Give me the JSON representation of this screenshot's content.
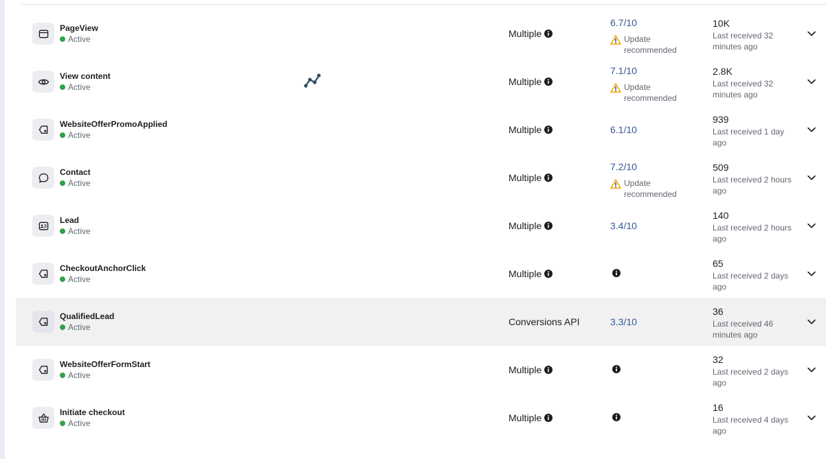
{
  "events": [
    {
      "name": "PageView",
      "status": "Active",
      "icon": "browser-window-icon",
      "integration": "Multiple",
      "score": "6.7/10",
      "warning": "Update recommended",
      "count": "10K",
      "last_received": "Last received 32 minutes ago"
    },
    {
      "name": "View content",
      "status": "Active",
      "icon": "eye-icon",
      "integration": "Multiple",
      "score": "7.1/10",
      "warning": "Update recommended",
      "count": "2.8K",
      "last_received": "Last received 32 minutes ago"
    },
    {
      "name": "WebsiteOfferPromoApplied",
      "status": "Active",
      "icon": "custom-event-tag-icon",
      "integration": "Multiple",
      "score": "6.1/10",
      "warning": "",
      "count": "939",
      "last_received": "Last received 1 day ago"
    },
    {
      "name": "Contact",
      "status": "Active",
      "icon": "chat-bubble-icon",
      "integration": "Multiple",
      "score": "7.2/10",
      "warning": "Update recommended",
      "count": "509",
      "last_received": "Last received 2 hours ago"
    },
    {
      "name": "Lead",
      "status": "Active",
      "icon": "contact-card-icon",
      "integration": "Multiple",
      "score": "3.4/10",
      "warning": "",
      "count": "140",
      "last_received": "Last received 2 hours ago"
    },
    {
      "name": "CheckoutAnchorClick",
      "status": "Active",
      "icon": "custom-event-tag-icon",
      "integration": "Multiple",
      "score": "",
      "warning": "",
      "count": "65",
      "last_received": "Last received 2 days ago"
    },
    {
      "name": "QualifiedLead",
      "status": "Active",
      "icon": "custom-event-tag-icon",
      "integration": "Conversions API",
      "score": "3.3/10",
      "warning": "",
      "count": "36",
      "last_received": "Last received 46 minutes ago"
    },
    {
      "name": "WebsiteOfferFormStart",
      "status": "Active",
      "icon": "custom-event-tag-icon",
      "integration": "Multiple",
      "score": "",
      "warning": "",
      "count": "32",
      "last_received": "Last received 2 days ago"
    },
    {
      "name": "Initiate checkout",
      "status": "Active",
      "icon": "basket-icon",
      "integration": "Multiple",
      "score": "",
      "warning": "",
      "count": "16",
      "last_received": "Last received 4 days ago"
    }
  ],
  "colors": {
    "active": "#31a24c",
    "score_link": "#385898",
    "warning": "#f0a70f",
    "row_highlight": "#f1f1f1"
  }
}
